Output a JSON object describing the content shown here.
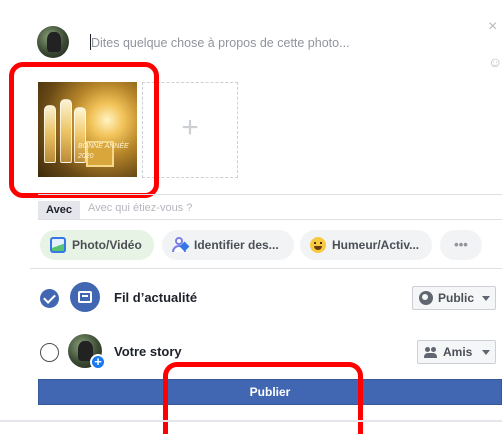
{
  "composer": {
    "caption_placeholder": "Dites quelque chose à propos de cette photo...",
    "close_glyph": "×",
    "emoji_glyph": "☺"
  },
  "media": {
    "thumbnail_text": "BONNE ANNÉE\n2020",
    "add_glyph": "+"
  },
  "with": {
    "label": "Avec",
    "placeholder": "Avec qui étiez-vous ?"
  },
  "actions": [
    {
      "label": "Photo/Vidéo",
      "icon": "photo-icon"
    },
    {
      "label": "Identifier des...",
      "icon": "tag-people-icon"
    },
    {
      "label": "Humeur/Activ...",
      "icon": "smiley-icon"
    },
    {
      "label": "•••",
      "icon": "more-icon"
    }
  ],
  "destinations": {
    "feed": {
      "label": "Fil d’actualité",
      "checked": true,
      "audience": "Public",
      "audience_icon": "globe-icon"
    },
    "story": {
      "label": "Votre story",
      "checked": false,
      "audience": "Amis",
      "audience_icon": "friends-icon"
    }
  },
  "publish": {
    "label": "Publier"
  },
  "colors": {
    "accent": "#4267b2",
    "highlight": "#ff0000"
  }
}
